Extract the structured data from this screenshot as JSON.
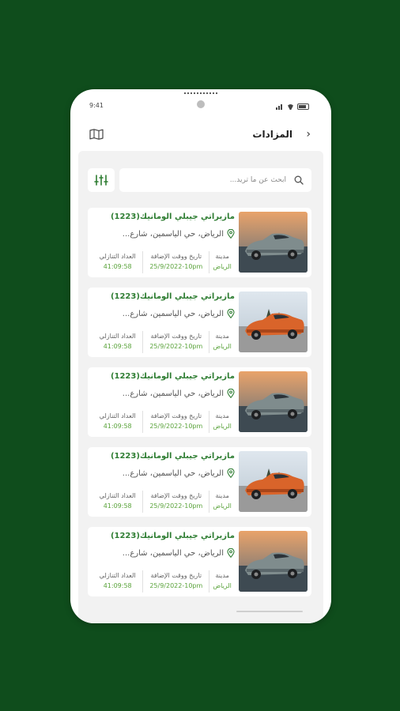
{
  "status": {
    "time": "9:41"
  },
  "header": {
    "title": "المزادات",
    "back_icon": "chevron-right-icon",
    "map_icon": "map-icon"
  },
  "search": {
    "placeholder": "ابحث عن ما تريد..."
  },
  "grid_labels": {
    "city": "مدينة",
    "date": "تاريخ ووقت الإضافة",
    "countdown": "العداد التنازلي"
  },
  "cards": [
    {
      "title": "مازيراتي جيبلي الومانيك(1223)",
      "location": "الرياض، حي الياسمين، شارع...",
      "city": "الرياض",
      "date": "25/9/2022-10pm",
      "countdown": "41:09:58",
      "car_color": "grey"
    },
    {
      "title": "مازيراتي جيبلي الومانيك(1223)",
      "location": "الرياض، حي الياسمين، شارع...",
      "city": "الرياض",
      "date": "25/9/2022-10pm",
      "countdown": "41:09:58",
      "car_color": "orange"
    },
    {
      "title": "مازيراتي جيبلي الومانيك(1223)",
      "location": "الرياض، حي الياسمين، شارع...",
      "city": "الرياض",
      "date": "25/9/2022-10pm",
      "countdown": "41:09:58",
      "car_color": "grey"
    },
    {
      "title": "مازيراتي جيبلي الومانيك(1223)",
      "location": "الرياض، حي الياسمين، شارع...",
      "city": "الرياض",
      "date": "25/9/2022-10pm",
      "countdown": "41:09:58",
      "car_color": "orange"
    },
    {
      "title": "مازيراتي جيبلي الومانيك(1223)",
      "location": "الرياض، حي الياسمين، شارع...",
      "city": "الرياض",
      "date": "25/9/2022-10pm",
      "countdown": "41:09:58",
      "car_color": "grey"
    }
  ],
  "colors": {
    "background": "#0f4d1c",
    "accent_green": "#2e7d32",
    "value_green": "#5aa33b"
  }
}
